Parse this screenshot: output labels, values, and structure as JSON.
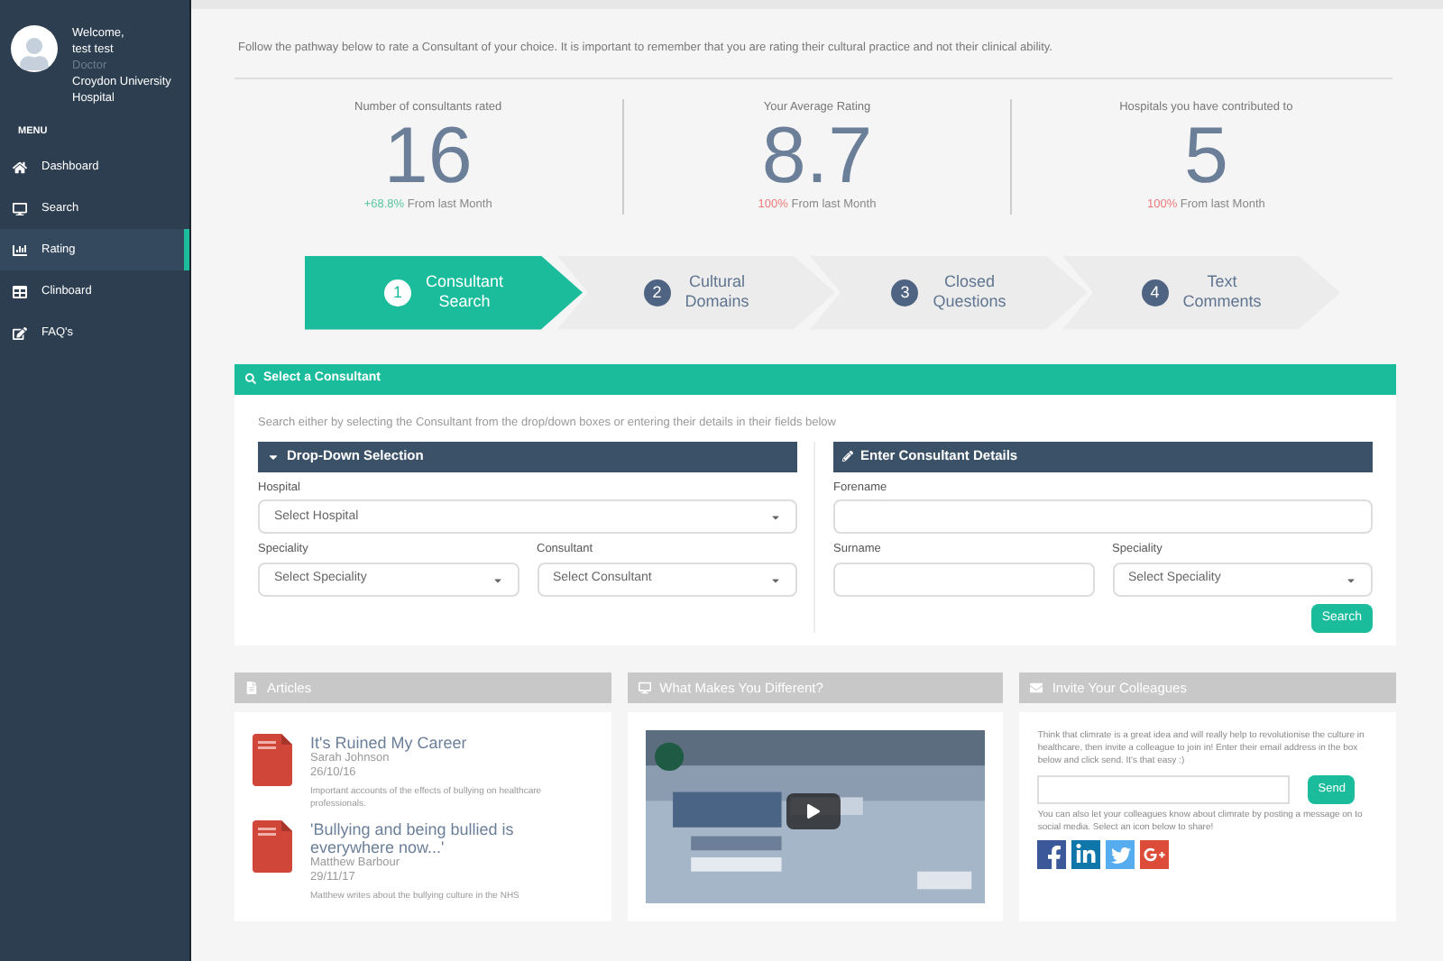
{
  "sidebar": {
    "welcome": "Welcome,",
    "user": "test test",
    "role": "Doctor",
    "hospital": "Croydon University Hospital",
    "menu_label": "MENU",
    "items": [
      {
        "label": "Dashboard",
        "selected": false
      },
      {
        "label": "Search",
        "selected": false
      },
      {
        "label": "Rating",
        "selected": true
      },
      {
        "label": "Clinboard",
        "selected": false
      },
      {
        "label": "FAQ's",
        "selected": false
      }
    ]
  },
  "intro": "Follow the pathway below to rate a Consultant of your choice. It is important to remember that you are rating their cultural practice and not their clinical ability.",
  "stats": [
    {
      "label": "Number of consultants rated",
      "value": "16",
      "change": "+68.8%",
      "color": "#5cc6a0",
      "suffix": "From last Month"
    },
    {
      "label": "Your Average Rating",
      "value": "8.7",
      "change": "100%",
      "color": "#f07a7a",
      "suffix": "From last Month"
    },
    {
      "label": "Hospitals you have contributed to",
      "value": "5",
      "change": "100%",
      "color": "#f07a7a",
      "suffix": "From last Month"
    }
  ],
  "steps": [
    {
      "number": "1",
      "line1": "Consultant",
      "line2": "Search",
      "selected": true
    },
    {
      "number": "2",
      "line1": "Cultural",
      "line2": "Domains",
      "selected": false
    },
    {
      "number": "3",
      "line1": "Closed",
      "line2": "Questions",
      "selected": false
    },
    {
      "number": "4",
      "line1": "Text",
      "line2": "Comments",
      "selected": false
    }
  ],
  "select_panel": {
    "title": "Select a Consultant",
    "hint": "Search either by selecting the Consultant from the drop/down boxes or entering their details in their fields below",
    "dropdown_section": {
      "title": "Drop-Down Selection",
      "hospital_label": "Hospital",
      "hospital_value": "Select Hospital",
      "speciality_label": "Speciality",
      "speciality_value": "Select Speciality",
      "consultant_label": "Consultant",
      "consultant_value": "Select Consultant"
    },
    "details_section": {
      "title": "Enter Consultant Details",
      "forename_label": "Forename",
      "surname_label": "Surname",
      "speciality_label": "Speciality",
      "speciality_value": "Select Speciality"
    },
    "search_button": "Search"
  },
  "articles": {
    "title": "Articles",
    "items": [
      {
        "title": "It's Ruined My Career",
        "author": "Sarah Johnson",
        "date": "26/10/16",
        "summary": "Important accounts of the effects of bullying on healthcare professionals."
      },
      {
        "title": "'Bullying and being bullied is everywhere now...'",
        "author": "Matthew Barbour",
        "date": "29/11/17",
        "summary": "Matthew writes about the bullying culture in the NHS"
      }
    ]
  },
  "video": {
    "title": "What Makes You Different?",
    "kind": "picture"
  },
  "invite": {
    "title": "Invite Your Colleagues",
    "text": "Think that climrate is a great idea and will really help to revolutionise the culture in healthcare, then invite a colleague to join in! Enter their email address in the box below and click send. It's that easy :)",
    "send_button": "Send",
    "social_text": "You can also let your colleagues know about climrate by posting a message on to social media. Select an icon below to share!"
  }
}
